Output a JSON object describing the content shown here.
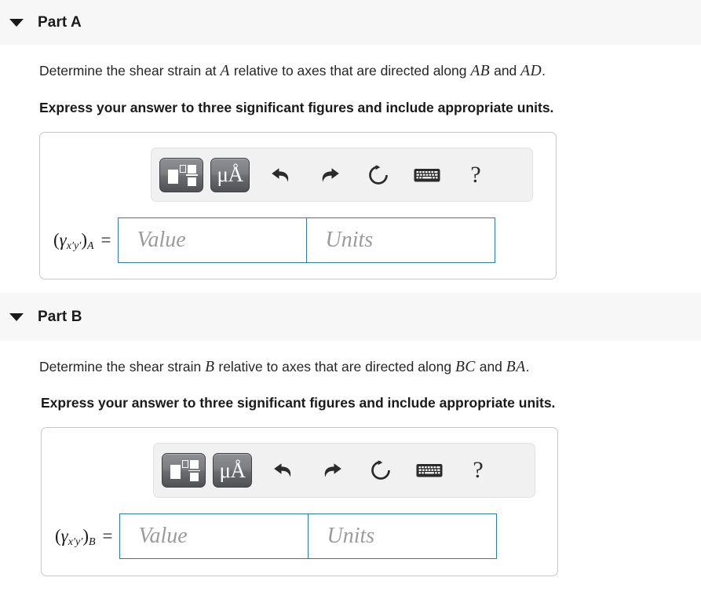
{
  "parts": [
    {
      "id": "part-a",
      "caret_icon": "caret-down-icon",
      "title": "Part A",
      "question_pre": "Determine the shear strain at ",
      "question_var1": "A",
      "question_mid": " relative to axes that are directed along ",
      "question_var2": "AB",
      "question_join": " and ",
      "question_var3": "AD",
      "question_end": ".",
      "instruction": "Express your answer to three significant figures and include appropriate units.",
      "answer": {
        "label_open": "(",
        "label_gamma": "γ",
        "label_sub_axes": "x′y′",
        "label_close": ")",
        "label_sub_point": "A",
        "label_equals": "=",
        "value_placeholder": "Value",
        "units_placeholder": "Units"
      },
      "toolbar": {
        "template_button": "template-icon",
        "units_button": "μÅ",
        "undo": "undo-icon",
        "redo": "redo-icon",
        "reset": "reset-icon",
        "keyboard": "keyboard-icon",
        "help": "?"
      }
    },
    {
      "id": "part-b",
      "caret_icon": "caret-down-icon",
      "title": "Part B",
      "question_pre": "Determine the shear strain ",
      "question_var1": "B",
      "question_mid": " relative to axes that are directed along ",
      "question_var2": "BC",
      "question_join": " and ",
      "question_var3": "BA",
      "question_end": ".",
      "instruction": "Express your answer to three significant figures and include appropriate units.",
      "answer": {
        "label_open": "(",
        "label_gamma": "γ",
        "label_sub_axes": "x′y′",
        "label_close": ")",
        "label_sub_point": "B",
        "label_equals": "=",
        "value_placeholder": "Value",
        "units_placeholder": "Units"
      },
      "toolbar": {
        "template_button": "template-icon",
        "units_button": "μÅ",
        "undo": "undo-icon",
        "redo": "redo-icon",
        "reset": "reset-icon",
        "keyboard": "keyboard-icon",
        "help": "?"
      }
    }
  ],
  "colors": {
    "header_band": "#f7f7f7",
    "input_border": "#2a7d9e",
    "panel_border": "#c8c8c8",
    "text": "#262626",
    "placeholder": "#9b9b9b"
  }
}
